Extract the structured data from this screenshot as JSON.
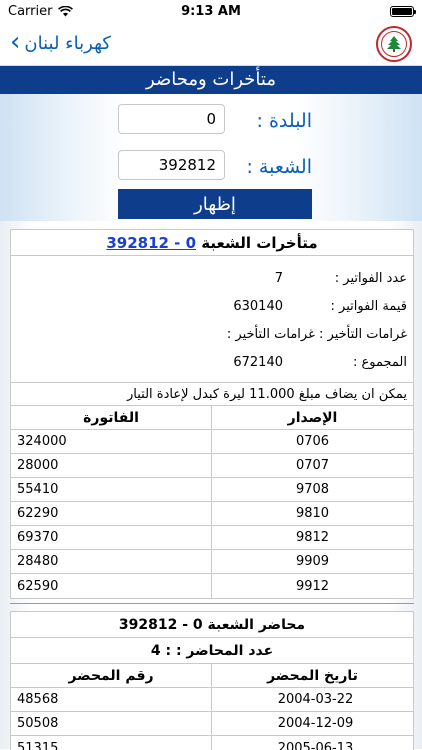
{
  "status": {
    "carrier": "Carrier",
    "time": "9:13 AM"
  },
  "nav": {
    "back_label": "كهرباء لبنان"
  },
  "header": {
    "title": "متأخرات ومحاضر"
  },
  "form": {
    "town_label": "البلدة :",
    "town_value": "0",
    "branch_label": "الشعبة :",
    "branch_value": "392812",
    "show_label": "إظهار"
  },
  "arrears": {
    "title_prefix": "متأخرات الشعبة",
    "title_link": "0 - 392812",
    "invoices_count_label": "عدد الفواتير :",
    "invoices_count": "7",
    "invoices_value_label": "قيمة الفواتير :",
    "invoices_value": "630140",
    "penalties_text": "غرامات التأخير : غرامات التأخير :",
    "total_label": "المجموع :",
    "total": "672140",
    "note": "يمكن ان يضاف مبلغ 11.000 ليرة كبدل لإعادة التيار",
    "col_issue": "الإصدار",
    "col_invoice": "الفاتورة",
    "rows": [
      {
        "issue": "0706",
        "invoice": "324000"
      },
      {
        "issue": "0707",
        "invoice": "28000"
      },
      {
        "issue": "9708",
        "invoice": "55410"
      },
      {
        "issue": "9810",
        "invoice": "62290"
      },
      {
        "issue": "9812",
        "invoice": "69370"
      },
      {
        "issue": "9909",
        "invoice": "28480"
      },
      {
        "issue": "9912",
        "invoice": "62590"
      }
    ]
  },
  "reports": {
    "title": "محاضر الشعبة 0 - 392812",
    "count_text": "عدد المحاضر : : 4",
    "col_date": "تاريخ المحضر",
    "col_number": "رقم المحضر",
    "rows": [
      {
        "date": "2004-03-22",
        "number": "48568"
      },
      {
        "date": "2004-12-09",
        "number": "50508"
      },
      {
        "date": "2005-06-13",
        "number": "51315"
      }
    ]
  },
  "colors": {
    "primary": "#0e3d8c",
    "link": "#0a5fb4",
    "logo": "#c0262c"
  }
}
